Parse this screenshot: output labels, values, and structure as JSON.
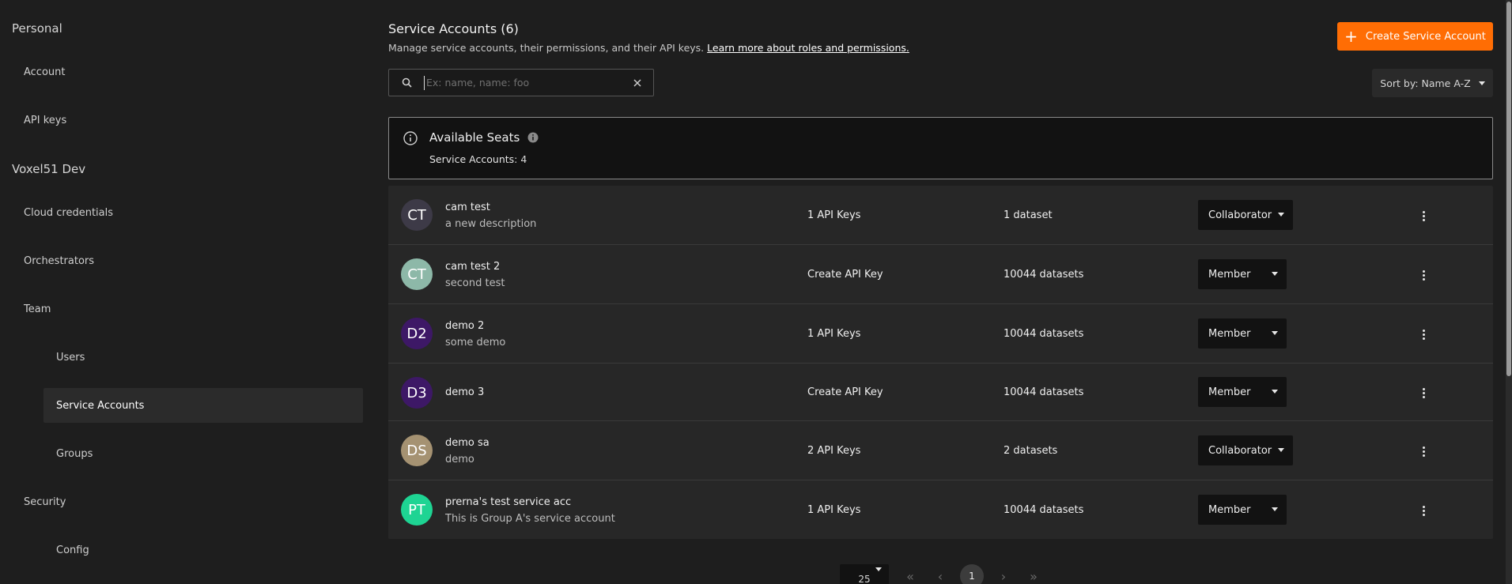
{
  "sidebar": {
    "personal_label": "Personal",
    "account": "Account",
    "api_keys": "API keys",
    "org_label": "Voxel51 Dev",
    "cloud_credentials": "Cloud credentials",
    "orchestrators": "Orchestrators",
    "team": "Team",
    "users": "Users",
    "service_accounts": "Service Accounts",
    "groups": "Groups",
    "security": "Security",
    "config": "Config"
  },
  "header": {
    "title": "Service Accounts (6)",
    "description": "Manage service accounts, their permissions, and their API keys.",
    "learn_more": "Learn more about roles and permissions.",
    "create_button": "Create Service Account"
  },
  "search": {
    "placeholder": "Ex: name, name: foo",
    "value": ""
  },
  "sort": {
    "label": "Sort by: Name A-Z"
  },
  "seats": {
    "title": "Available Seats",
    "label": "Service Accounts",
    "value": ": 4"
  },
  "accounts": [
    {
      "initials": "CT",
      "color": "#3d3a47",
      "name": "cam test",
      "description": "a new description",
      "keys": "1 API Keys",
      "datasets": "1 dataset",
      "role": "Collaborator"
    },
    {
      "initials": "CT",
      "color": "#8db8a8",
      "name": "cam test 2",
      "description": "second test",
      "keys": "Create API Key",
      "datasets": "10044 datasets",
      "role": "Member"
    },
    {
      "initials": "D2",
      "color": "#3d1866",
      "name": "demo 2",
      "description": "some demo",
      "keys": "1 API Keys",
      "datasets": "10044 datasets",
      "role": "Member"
    },
    {
      "initials": "D3",
      "color": "#3d1866",
      "name": "demo 3",
      "description": "",
      "keys": "Create API Key",
      "datasets": "10044 datasets",
      "role": "Member"
    },
    {
      "initials": "DS",
      "color": "#a59272",
      "name": "demo sa",
      "description": "demo",
      "keys": "2 API Keys",
      "datasets": "2 datasets",
      "role": "Collaborator"
    },
    {
      "initials": "PT",
      "color": "#1ed493",
      "name": "prerna's test service acc",
      "description": "This is Group A's service account",
      "keys": "1 API Keys",
      "datasets": "10044 datasets",
      "role": "Member"
    }
  ],
  "pagination": {
    "per_page": "25",
    "current_page": "1",
    "first": "«",
    "prev": "‹",
    "next": "›",
    "last": "»"
  }
}
